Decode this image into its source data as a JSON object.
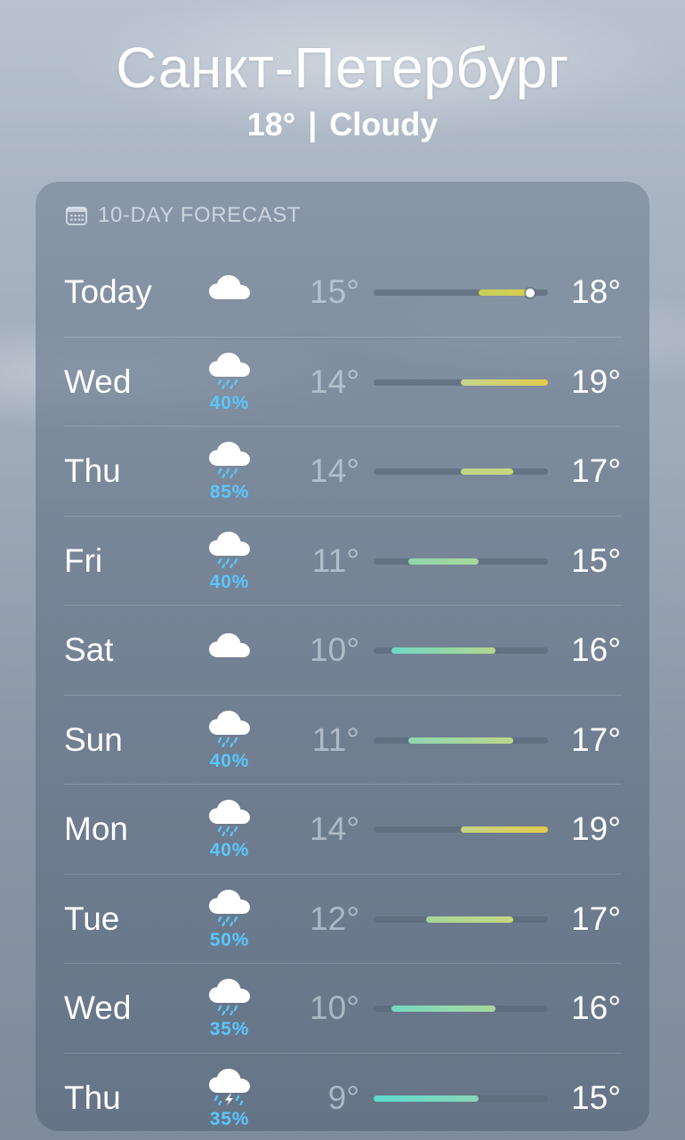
{
  "location": {
    "city": "Санкт-Петербург",
    "current_temp": "18°",
    "separator": "|",
    "condition": "Cloudy"
  },
  "forecast": {
    "title": "10-DAY FORECAST",
    "header_icon": "calendar-icon",
    "range_min": 9,
    "range_max": 19,
    "current_temp_value": 18,
    "days": [
      {
        "day": "Today",
        "icon": "cloud-icon",
        "precip": "",
        "low": "15°",
        "high": "18°",
        "low_value": 15,
        "high_value": 18,
        "bar_colors": [
          "#c7cf5a",
          "#d9d24e"
        ],
        "current": true
      },
      {
        "day": "Wed",
        "icon": "cloud-rain-icon",
        "precip": "40%",
        "low": "14°",
        "high": "19°",
        "low_value": 14,
        "high_value": 19,
        "bar_colors": [
          "#c5d58a",
          "#e4cc4c"
        ]
      },
      {
        "day": "Thu",
        "icon": "cloud-rain-icon",
        "precip": "85%",
        "low": "14°",
        "high": "17°",
        "low_value": 14,
        "high_value": 17,
        "bar_colors": [
          "#bed78a",
          "#cad57c"
        ]
      },
      {
        "day": "Fri",
        "icon": "cloud-rain-icon",
        "precip": "40%",
        "low": "11°",
        "high": "15°",
        "low_value": 11,
        "high_value": 15,
        "bar_colors": [
          "#8fd6ae",
          "#a9d79a"
        ]
      },
      {
        "day": "Sat",
        "icon": "cloud-icon",
        "precip": "",
        "low": "10°",
        "high": "16°",
        "low_value": 10,
        "high_value": 16,
        "bar_colors": [
          "#6fd8c6",
          "#b3d68f"
        ]
      },
      {
        "day": "Sun",
        "icon": "cloud-rain-icon",
        "precip": "40%",
        "low": "11°",
        "high": "17°",
        "low_value": 11,
        "high_value": 17,
        "bar_colors": [
          "#8dd7b0",
          "#bcd68c"
        ]
      },
      {
        "day": "Mon",
        "icon": "cloud-rain-icon",
        "precip": "40%",
        "low": "14°",
        "high": "19°",
        "low_value": 14,
        "high_value": 19,
        "bar_colors": [
          "#c6d587",
          "#e4cc4c"
        ]
      },
      {
        "day": "Tue",
        "icon": "cloud-rain-icon",
        "precip": "50%",
        "low": "12°",
        "high": "17°",
        "low_value": 12,
        "high_value": 17,
        "bar_colors": [
          "#a7d69c",
          "#c6d57f"
        ]
      },
      {
        "day": "Wed",
        "icon": "cloud-rain-icon",
        "precip": "35%",
        "low": "10°",
        "high": "16°",
        "low_value": 10,
        "high_value": 16,
        "bar_colors": [
          "#74d8c2",
          "#a9d79a"
        ]
      },
      {
        "day": "Thu",
        "icon": "cloud-bolt-rain-icon",
        "precip": "35%",
        "low": "9°",
        "high": "15°",
        "low_value": 9,
        "high_value": 15,
        "bar_colors": [
          "#5fd8cf",
          "#88d7b6"
        ]
      }
    ]
  }
}
